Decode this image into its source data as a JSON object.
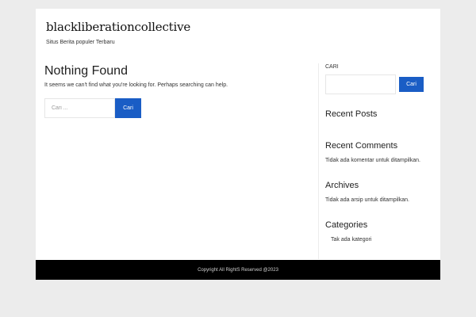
{
  "site": {
    "title": "blackliberationcollective",
    "tagline": "Situs Berita populer Terbaru"
  },
  "main": {
    "heading": "Nothing Found",
    "message": "It seems we can't find what you're looking for. Perhaps searching can help.",
    "search": {
      "placeholder": "Cari ...",
      "button_label": "Cari"
    }
  },
  "sidebar": {
    "search": {
      "label": "CARI",
      "button_label": "Cari"
    },
    "recent_posts": {
      "title": "Recent Posts"
    },
    "recent_comments": {
      "title": "Recent Comments",
      "text": "Tidak ada komentar untuk ditampilkan."
    },
    "archives": {
      "title": "Archives",
      "text": "Tidak ada arsip untuk ditampilkan."
    },
    "categories": {
      "title": "Categories",
      "text": "Tak ada kategori"
    }
  },
  "footer": {
    "copyright": "Copyright All RightS Reserved @2023"
  },
  "colors": {
    "accent": "#1a5dc5",
    "page_background": "#ececec",
    "footer_background": "#000000"
  }
}
